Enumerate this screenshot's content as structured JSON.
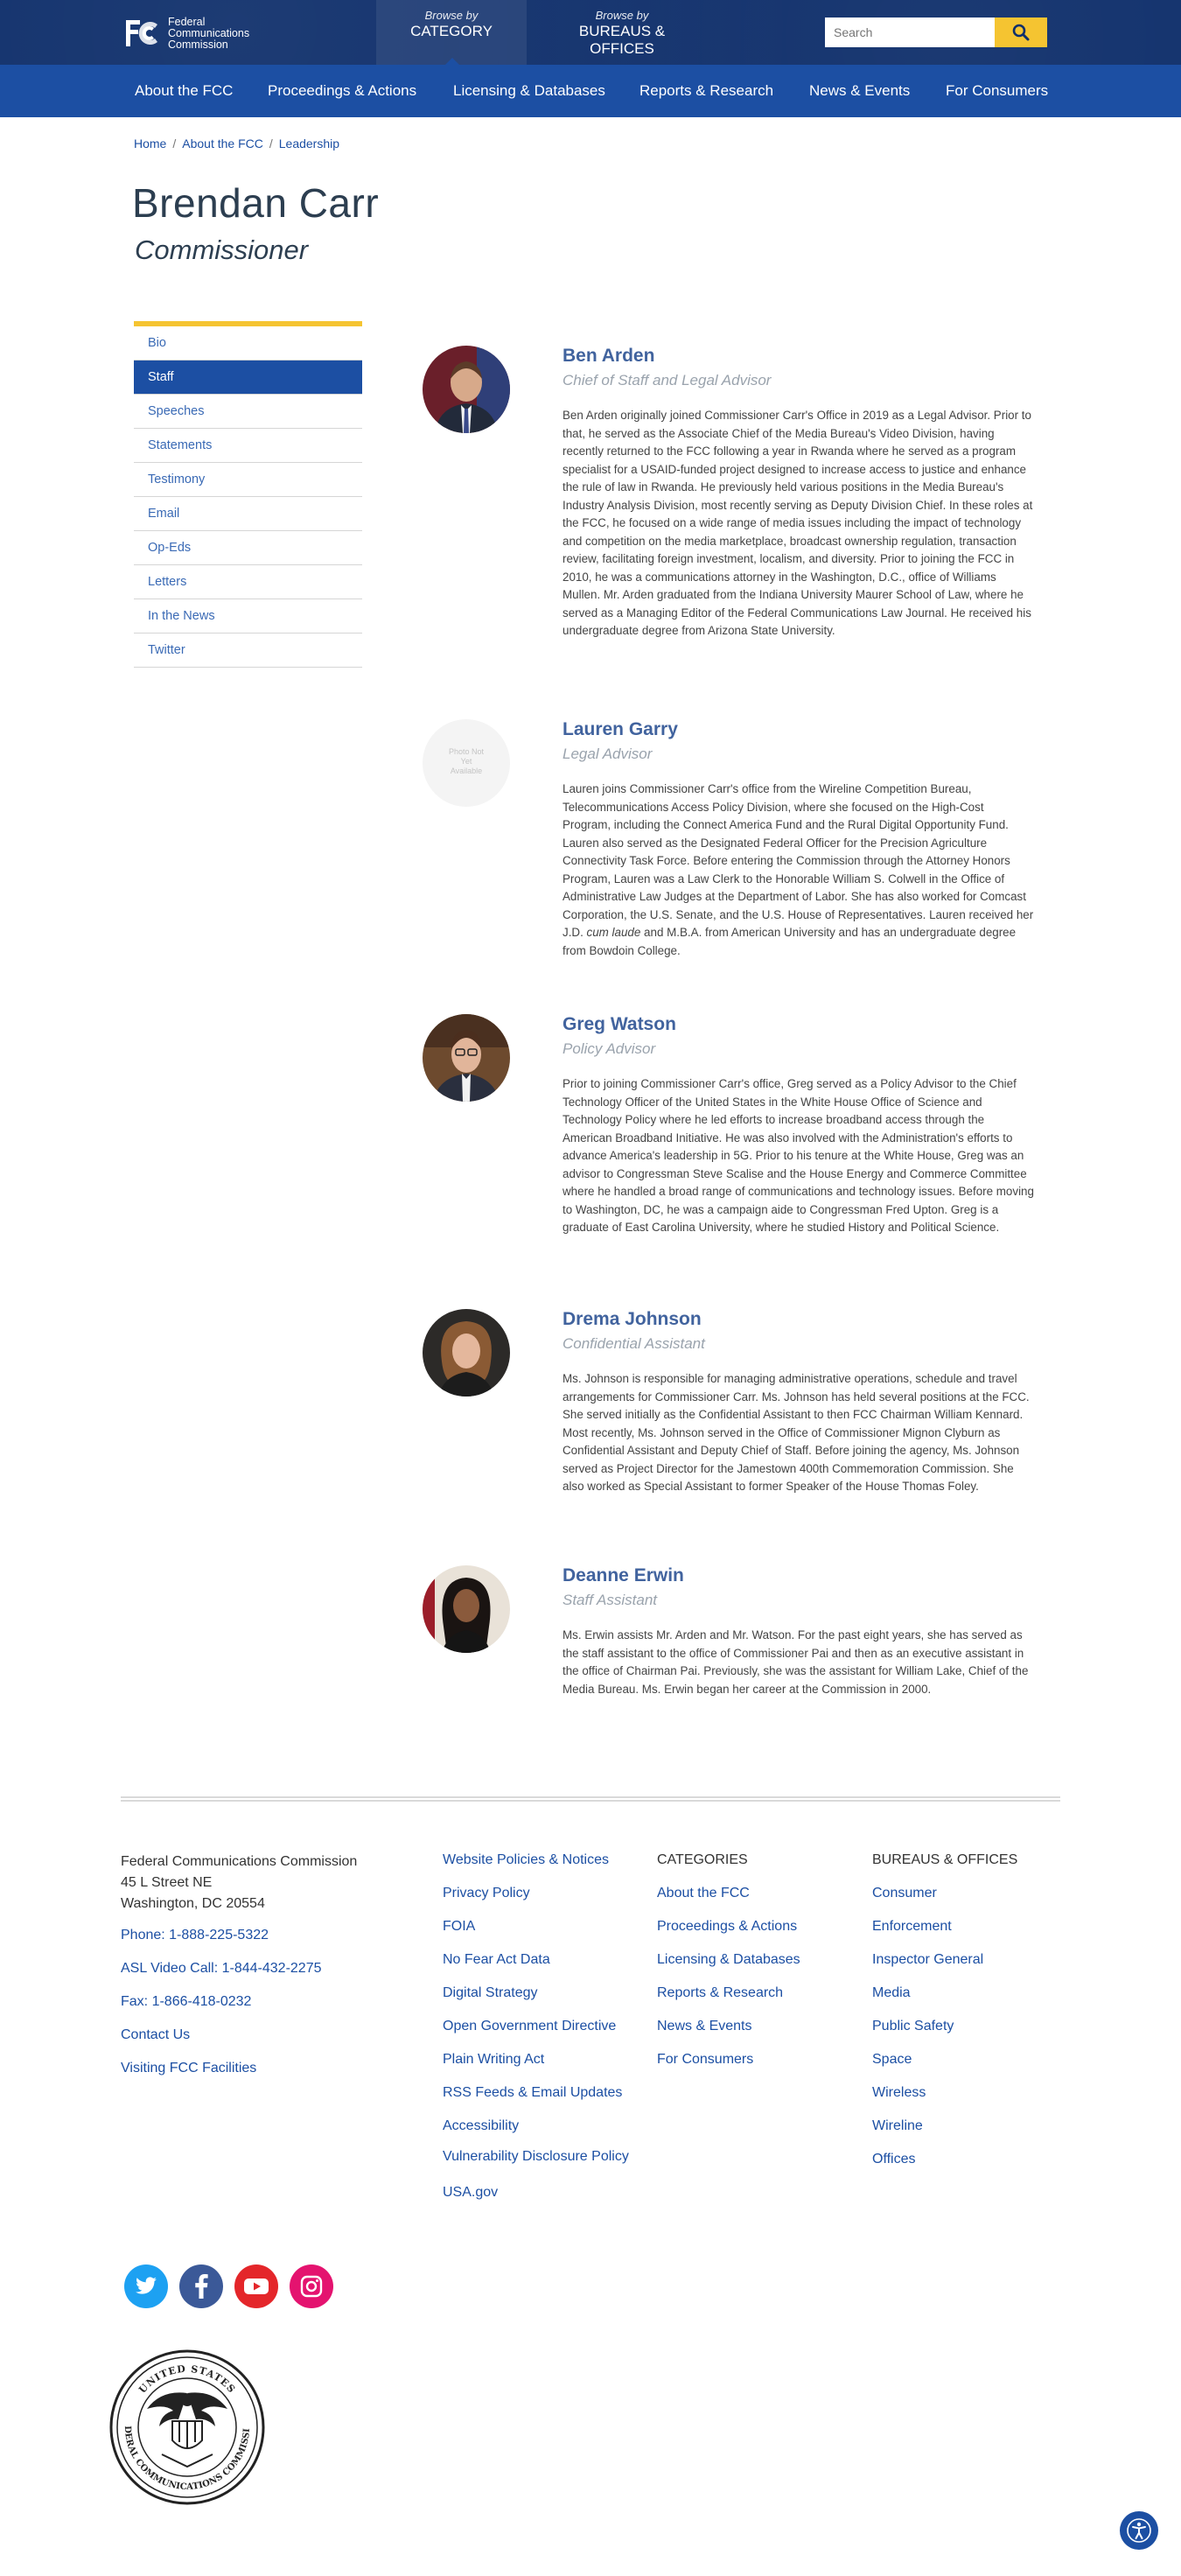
{
  "header": {
    "logo_line1": "Federal",
    "logo_line2": "Communications",
    "logo_line3": "Commission",
    "browse_category_top": "Browse by",
    "browse_category": "CATEGORY",
    "browse_bureaus_top": "Browse by",
    "browse_bureaus": "BUREAUS & OFFICES",
    "search_placeholder": "Search"
  },
  "nav": [
    "About the FCC",
    "Proceedings & Actions",
    "Licensing & Databases",
    "Reports & Research",
    "News & Events",
    "For Consumers"
  ],
  "breadcrumb": [
    "Home",
    "About the FCC",
    "Leadership"
  ],
  "page": {
    "title": "Brendan Carr",
    "subtitle": "Commissioner"
  },
  "sidebar": [
    "Bio",
    "Staff",
    "Speeches",
    "Statements",
    "Testimony",
    "Email",
    "Op-Eds",
    "Letters",
    "In the News",
    "Twitter"
  ],
  "sidebar_active": "Staff",
  "staff": [
    {
      "name": "Ben Arden",
      "role": "Chief of Staff and Legal Advisor",
      "bio": "Ben Arden originally joined Commissioner Carr's Office in 2019 as a Legal Advisor. Prior to that, he served as the Associate Chief of the Media Bureau's Video Division, having recently returned to the FCC following a year in Rwanda where he served as a program specialist for a USAID-funded project designed to increase access to justice and enhance the rule of law in Rwanda. He previously held various positions in the Media Bureau's Industry Analysis Division, most recently serving as Deputy Division Chief. In these roles at the FCC, he focused on a wide range of media issues including the impact of technology and competition on the media marketplace, broadcast ownership regulation, transaction review, facilitating foreign investment, localism, and diversity. Prior to joining the FCC in 2010, he was a communications attorney in the Washington, D.C., office of Williams Mullen. Mr. Arden graduated from the Indiana University Maurer School of Law, where he served as a Managing Editor of the Federal Communications Law Journal. He received his undergraduate degree from Arizona State University."
    },
    {
      "name": "Lauren Garry",
      "role": "Legal Advisor",
      "photo_placeholder": "Photo Not Yet Available",
      "bio_part1": "Lauren joins Commissioner Carr's office from the Wireline Competition Bureau, Telecommunications Access Policy Division, where she focused on the High-Cost Program, including the Connect America Fund and the Rural Digital Opportunity Fund. Lauren also served as the Designated Federal Officer for the Precision Agriculture Connectivity Task Force. Before entering the Commission through the Attorney Honors Program, Lauren was a Law Clerk to the Honorable William S. Colwell in the Office of Administrative Law Judges at the Department of Labor. She has also worked for Comcast Corporation, the U.S. Senate, and the U.S. House of Representatives. Lauren received her J.D. ",
      "bio_italic": "cum laude",
      "bio_part2": " and M.B.A. from American University and has an undergraduate degree from Bowdoin College."
    },
    {
      "name": "Greg Watson",
      "role": "Policy Advisor",
      "bio": "Prior to joining Commissioner Carr's office, Greg served as a Policy Advisor to the Chief Technology Officer of the United States in the White House Office of Science and Technology Policy where he led efforts to increase broadband access through the American Broadband Initiative. He was also involved with the Administration's efforts to advance America's leadership in 5G. Prior to his tenure at the White House, Greg was an advisor to Congressman Steve Scalise and the House Energy and Commerce Committee where he handled a broad range of communications and technology issues. Before moving to Washington, DC, he was a campaign aide to Congressman Fred Upton. Greg is a graduate of East Carolina University, where he studied History and Political Science."
    },
    {
      "name": "Drema Johnson",
      "role": "Confidential Assistant",
      "bio": "Ms. Johnson is responsible for managing administrative operations, schedule and travel arrangements for Commissioner Carr. Ms. Johnson has held several positions at the FCC. She served initially as the Confidential Assistant to then FCC Chairman William Kennard. Most recently, Ms. Johnson served in the Office of Commissioner Mignon Clyburn as Confidential Assistant and Deputy Chief of Staff. Before joining the agency, Ms. Johnson served as Project Director for the Jamestown 400th Commemoration Commission. She also worked as Special Assistant to former Speaker of the House Thomas Foley."
    },
    {
      "name": "Deanne Erwin",
      "role": "Staff Assistant",
      "bio": "Ms. Erwin assists Mr. Arden and Mr. Watson. For the past eight years, she has served as the staff assistant to the office of Commissioner Pai and then as an executive assistant in the office of Chairman Pai. Previously, she was the assistant for William Lake, Chief of the Media Bureau. Ms. Erwin began her career at the Commission in 2000."
    }
  ],
  "footer": {
    "org": "Federal Communications Commission",
    "street": "45 L Street NE",
    "city": "Washington, DC 20554",
    "phone": "Phone: 1-888-225-5322",
    "asl": "ASL Video Call: 1-844-432-2275",
    "fax": "Fax: 1-866-418-0232",
    "contact": "Contact Us",
    "visiting": "Visiting FCC Facilities",
    "policy_links": [
      "Website Policies & Notices",
      "Privacy Policy",
      "FOIA",
      "No Fear Act Data",
      "Digital Strategy",
      "Open Government Directive",
      "Plain Writing Act",
      "RSS Feeds & Email Updates",
      "Accessibility",
      "Vulnerability Disclosure Policy",
      "USA.gov"
    ],
    "categories_heading": "CATEGORIES",
    "categories": [
      "About the FCC",
      "Proceedings & Actions",
      "Licensing & Databases",
      "Reports & Research",
      "News & Events",
      "For Consumers"
    ],
    "bureaus_heading": "BUREAUS & OFFICES",
    "bureaus": [
      "Consumer",
      "Enforcement",
      "Inspector General",
      "Media",
      "Public Safety",
      "Space",
      "Wireless",
      "Wireline",
      "Offices"
    ],
    "social": [
      "twitter-icon",
      "facebook-icon",
      "youtube-icon",
      "instagram-icon"
    ],
    "seal_top_text": "UNITED STATES",
    "seal_bottom_text": "FEDERAL COMMUNICATIONS COMMISSION"
  },
  "colors": {
    "header": "#0f2f6b",
    "nav": "#1c4fa3",
    "accent": "#f5c431",
    "link": "#1c4fa3",
    "name": "#41639e"
  }
}
